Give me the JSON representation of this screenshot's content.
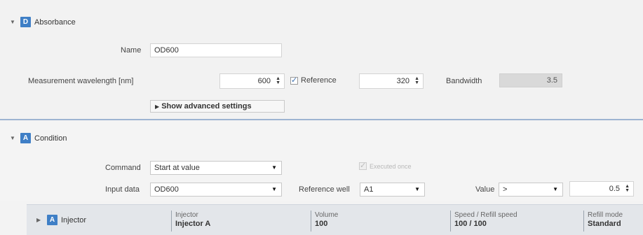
{
  "absorbance": {
    "badge": "D",
    "title": "Absorbance",
    "name_label": "Name",
    "name_value": "OD600",
    "wavelength_label": "Measurement wavelength [nm]",
    "wavelength_value": "600",
    "reference_label": "Reference",
    "reference_checked": true,
    "reference_value": "320",
    "bandwidth_label": "Bandwidth",
    "bandwidth_value": "3.5",
    "advanced_label": "Show advanced settings"
  },
  "condition": {
    "badge": "A",
    "title": "Condition",
    "command_label": "Command",
    "command_value": "Start at value",
    "executed_once_label": "Executed once",
    "input_label": "Input data",
    "input_value": "OD600",
    "reference_well_label": "Reference well",
    "reference_well_value": "A1",
    "value_label": "Value",
    "value_operator": ">",
    "value_number": "0.5"
  },
  "injector": {
    "badge": "A",
    "title": "Injector",
    "columns": [
      {
        "label": "Injector",
        "value": "Injector A"
      },
      {
        "label": "Volume",
        "value": "100"
      },
      {
        "label": "Speed / Refill speed",
        "value": "100 / 100"
      },
      {
        "label": "Refill mode",
        "value": "Standard"
      }
    ]
  },
  "colors": {
    "badge": "#3f7fc6",
    "section_divider": "#9db4d2"
  },
  "icons": {
    "expanded": "triangle-down-icon",
    "collapsed": "triangle-right-icon",
    "spin": "up-down-arrows-icon",
    "dropdown": "caret-down-icon"
  }
}
